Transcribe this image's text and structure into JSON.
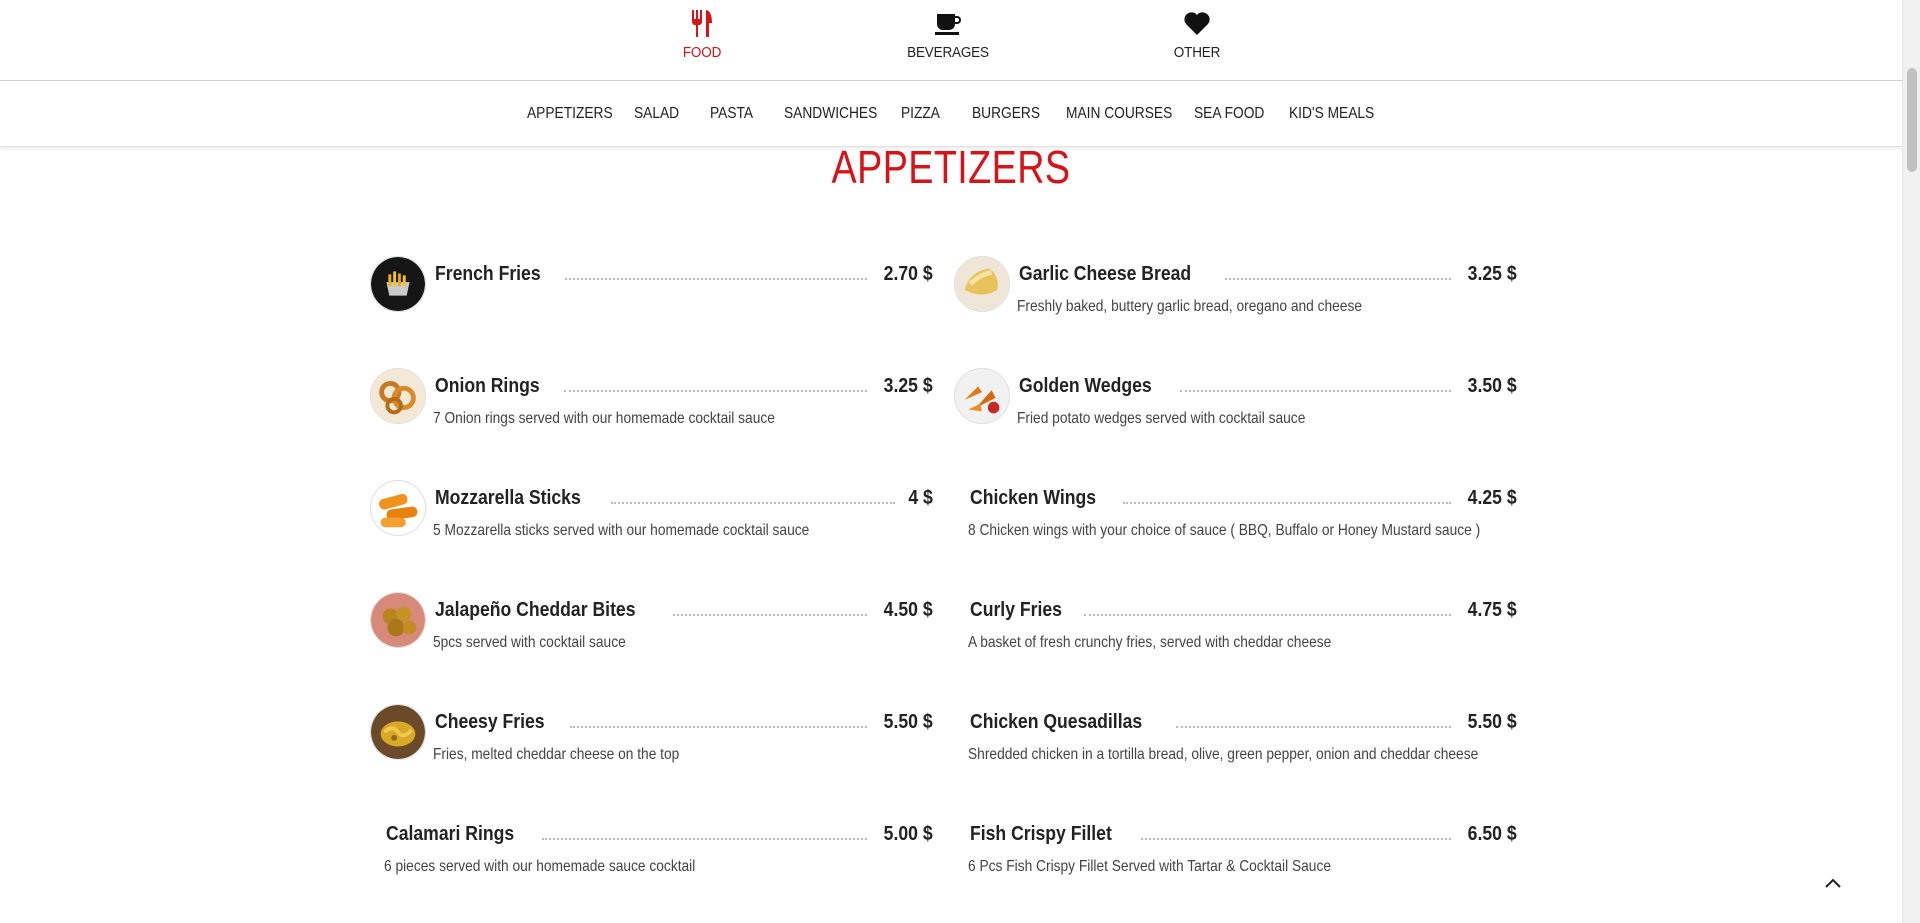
{
  "top_nav": [
    {
      "label": "FOOD",
      "icon": "utensils-icon",
      "active": true
    },
    {
      "label": "BEVERAGES",
      "icon": "coffee-cup-icon",
      "active": false
    },
    {
      "label": "OTHER",
      "icon": "heart-icon",
      "active": false
    }
  ],
  "categories": [
    "APPETIZERS",
    "SALAD",
    "PASTA",
    "SANDWICHES",
    "PIZZA",
    "BURGERS",
    "MAIN COURSES",
    "SEA FOOD",
    "KID'S MEALS"
  ],
  "section_title": "APPETIZERS",
  "colors": {
    "accent": "#d7131a",
    "text": "#222222",
    "dots": "#bbbbbb"
  },
  "items": [
    {
      "name": "French Fries",
      "price": "2.70 $",
      "desc": "",
      "image": "french-fries-thumbnail"
    },
    {
      "name": "Garlic Cheese Bread",
      "price": "3.25 $",
      "desc": "Freshly baked, buttery garlic bread, oregano and cheese",
      "image": "garlic-bread-thumbnail"
    },
    {
      "name": "Onion Rings",
      "price": "3.25 $",
      "desc": "7 Onion rings served with our homemade cocktail sauce",
      "image": "onion-rings-thumbnail"
    },
    {
      "name": "Golden Wedges",
      "price": "3.50 $",
      "desc": "Fried potato wedges served with cocktail sauce",
      "image": "potato-wedges-thumbnail"
    },
    {
      "name": "Mozzarella Sticks",
      "price": "4 $",
      "desc": "5 Mozzarella sticks served with our homemade cocktail sauce",
      "image": "mozzarella-sticks-thumbnail"
    },
    {
      "name": "Chicken Wings",
      "price": "4.25 $",
      "desc": "8 Chicken wings with your choice of sauce ( BBQ, Buffalo or Honey Mustard sauce )",
      "image": ""
    },
    {
      "name": "Jalapeño Cheddar Bites",
      "price": "4.50 $",
      "desc": "5pcs served with cocktail sauce",
      "image": "jalapeno-bites-thumbnail"
    },
    {
      "name": "Curly Fries",
      "price": "4.75 $",
      "desc": "A basket of fresh crunchy fries, served with cheddar cheese",
      "image": ""
    },
    {
      "name": "Cheesy Fries",
      "price": "5.50 $",
      "desc": "Fries, melted cheddar cheese on the top",
      "image": "cheesy-fries-thumbnail"
    },
    {
      "name": "Chicken Quesadillas",
      "price": "5.50 $",
      "desc": "Shredded chicken in a tortilla bread, olive, green pepper, onion and cheddar cheese",
      "image": ""
    },
    {
      "name": "Calamari Rings",
      "price": "5.00 $",
      "desc": "6 pieces served with our homemade sauce cocktail",
      "image": ""
    },
    {
      "name": "Fish Crispy Fillet",
      "price": "6.50 $",
      "desc": "6 Pcs Fish Crispy Fillet Served with Tartar & Cocktail Sauce",
      "image": ""
    }
  ]
}
